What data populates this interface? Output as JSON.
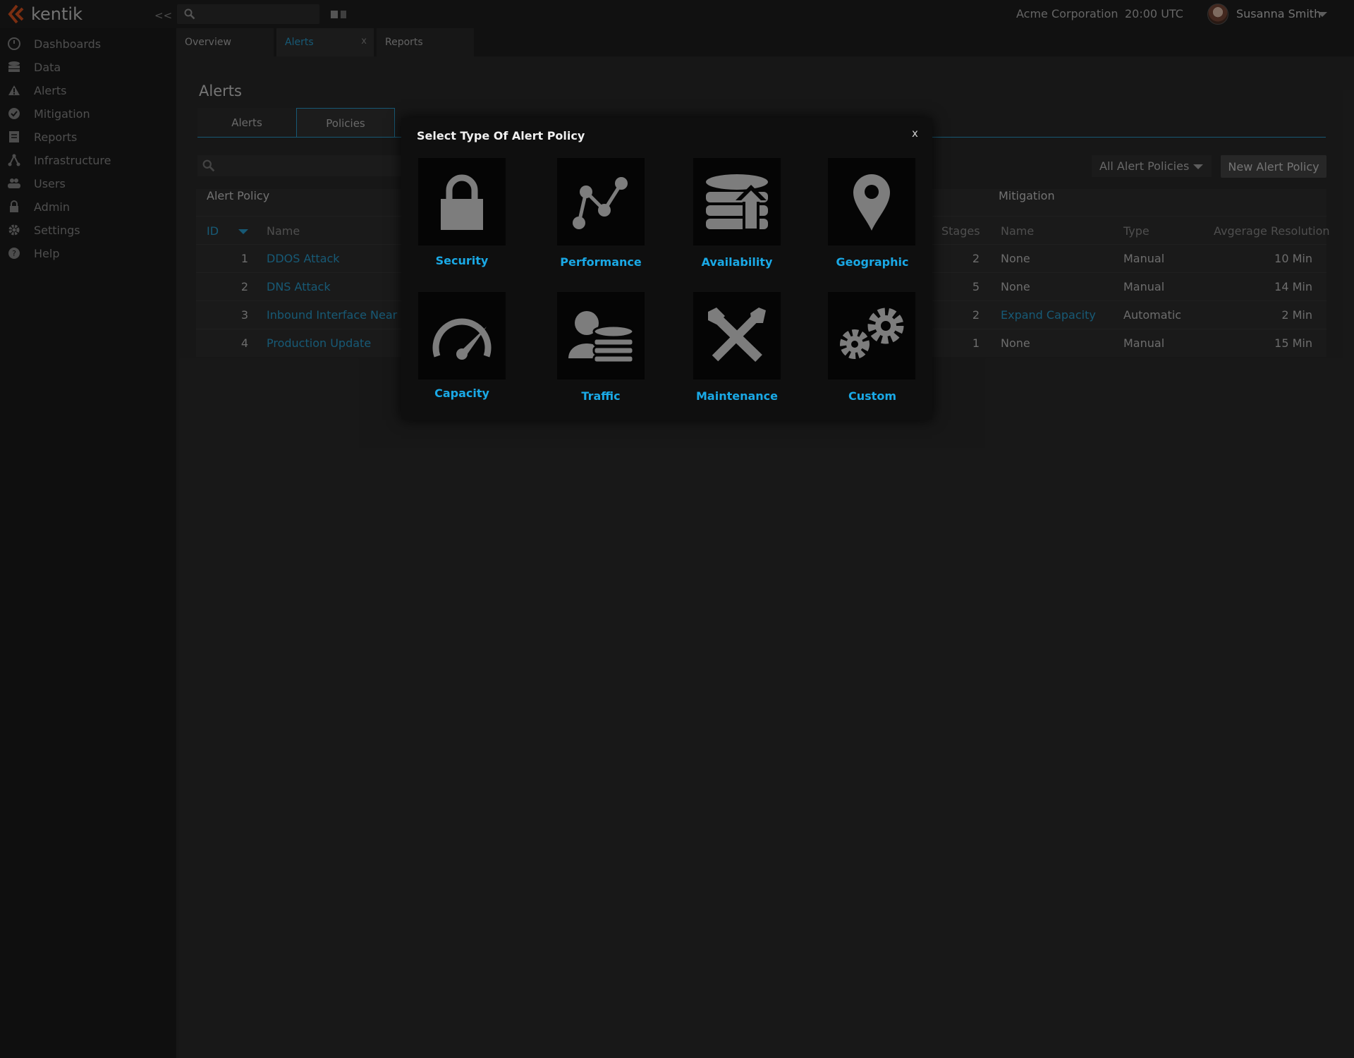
{
  "app": {
    "name": "kentik",
    "collapse_label": "<<",
    "organization": "Acme Corporation",
    "time": "20:00 UTC",
    "user_name": "Susanna Smith"
  },
  "sidebar": {
    "items": [
      {
        "label": "Dashboards",
        "icon": "dashboard-icon"
      },
      {
        "label": "Data",
        "icon": "database-icon"
      },
      {
        "label": "Alerts",
        "icon": "warning-icon"
      },
      {
        "label": "Mitigation",
        "icon": "check-circle-icon"
      },
      {
        "label": "Reports",
        "icon": "report-icon"
      },
      {
        "label": "Infrastructure",
        "icon": "network-icon"
      },
      {
        "label": "Users",
        "icon": "users-icon"
      },
      {
        "label": "Admin",
        "icon": "lock-icon"
      },
      {
        "label": "Settings",
        "icon": "gear-icon"
      },
      {
        "label": "Help",
        "icon": "help-icon"
      }
    ]
  },
  "tabs": [
    {
      "label": "Overview"
    },
    {
      "label": "Alerts",
      "close": "x"
    },
    {
      "label": "Reports"
    }
  ],
  "page": {
    "title": "Alerts",
    "subtabs": [
      "Alerts",
      "Policies"
    ],
    "filter_select": "All Alert Policies",
    "new_button": "New Alert Policy"
  },
  "table": {
    "group_alert_policy": "Alert Policy",
    "group_mitigation": "Mitigation",
    "headers": {
      "id": "ID",
      "name": "Name",
      "stages": "Stages",
      "mit_name": "Name",
      "mit_type": "Type",
      "avg_resolution": "Avgerage Resolution"
    },
    "rows": [
      {
        "id": "1",
        "name": "DDOS Attack",
        "stages": "2",
        "mit_name": "None",
        "mit_type": "Manual",
        "avg": "10 Min"
      },
      {
        "id": "2",
        "name": "DNS Attack",
        "stages": "5",
        "mit_name": "None",
        "mit_type": "Manual",
        "avg": "14 Min"
      },
      {
        "id": "3",
        "name": "Inbound Interface Near Ca",
        "stages": "2",
        "mit_name": "Expand Capacity",
        "mit_type": "Automatic",
        "avg": "2 Min"
      },
      {
        "id": "4",
        "name": "Production Update",
        "stages": "1",
        "mit_name": "None",
        "mit_type": "Manual",
        "avg": "15 Min"
      }
    ]
  },
  "modal": {
    "title": "Select Type Of Alert Policy",
    "close": "x",
    "options": [
      {
        "label": "Security",
        "icon": "lock-icon"
      },
      {
        "label": "Performance",
        "icon": "line-graph-icon"
      },
      {
        "label": "Availability",
        "icon": "database-upload-icon"
      },
      {
        "label": "Geographic",
        "icon": "map-pin-icon"
      },
      {
        "label": "Capacity",
        "icon": "speedometer-icon"
      },
      {
        "label": "Traffic",
        "icon": "user-database-icon"
      },
      {
        "label": "Maintenance",
        "icon": "tools-icon"
      },
      {
        "label": "Custom",
        "icon": "gears-icon"
      }
    ]
  },
  "colors": {
    "accent": "#2aa3d6",
    "option_label": "#1aa9e6",
    "brand": "#e0541f"
  }
}
